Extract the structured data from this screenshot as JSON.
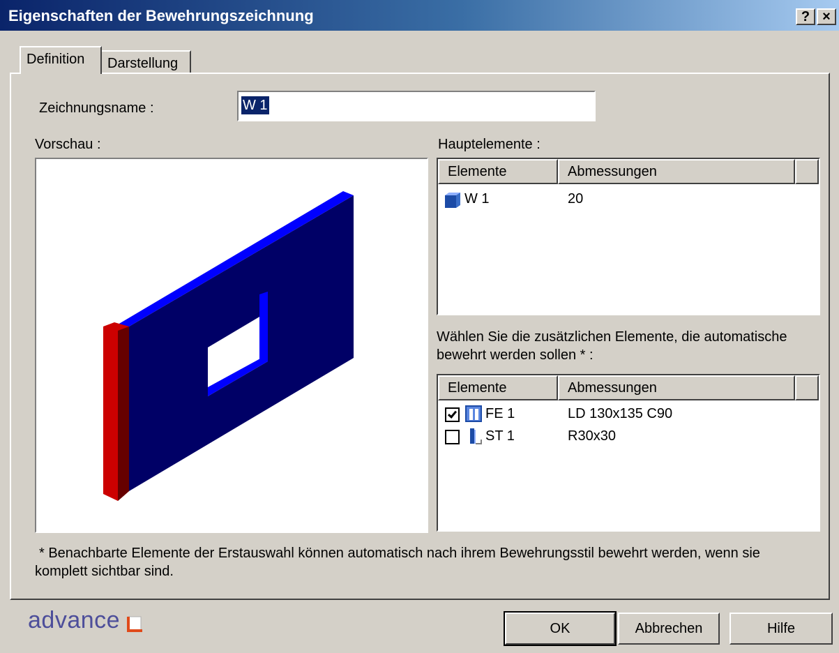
{
  "window": {
    "title": "Eigenschaften der Bewehrungszeichnung",
    "help_button": "?",
    "close_button": "×"
  },
  "tabs": [
    {
      "label": "Definition",
      "active": true
    },
    {
      "label": "Darstellung",
      "active": false
    }
  ],
  "drawing_name": {
    "label": "Zeichnungsname :",
    "value": "W 1"
  },
  "preview": {
    "label": "Vorschau :"
  },
  "main_elements": {
    "label": "Hauptelemente :",
    "columns": [
      "Elemente",
      "Abmessungen"
    ],
    "rows": [
      {
        "element": "W 1",
        "dimensions": "20",
        "icon": "wall-icon"
      }
    ]
  },
  "additional_elements": {
    "label_line1": "Wählen Sie die zusätzlichen Elemente, die automatische",
    "label_line2": "bewehrt werden sollen * :",
    "columns": [
      "Elemente",
      "Abmessungen"
    ],
    "rows": [
      {
        "element": "FE 1",
        "dimensions": "LD 130x135 C90",
        "checked": true,
        "icon": "window-icon"
      },
      {
        "element": "ST 1",
        "dimensions": "R30x30",
        "checked": false,
        "icon": "column-icon"
      }
    ]
  },
  "footnote": {
    "line1": "* Benachbarte Elemente der Erstauswahl können automatisch nach ihrem Bewehrungsstil bewehrt werden, wenn sie",
    "line2": "komplett sichtbar sind."
  },
  "logo": {
    "text": "advance"
  },
  "buttons": {
    "ok": "OK",
    "cancel": "Abbrechen",
    "help": "Hilfe"
  },
  "colors": {
    "title_bar": "#0a246a",
    "wall_front": "#000066",
    "wall_top": "#0000ff",
    "wall_side": "#cc0000",
    "logo": "#4d4e9a",
    "logo_accent": "#e04a1a"
  }
}
